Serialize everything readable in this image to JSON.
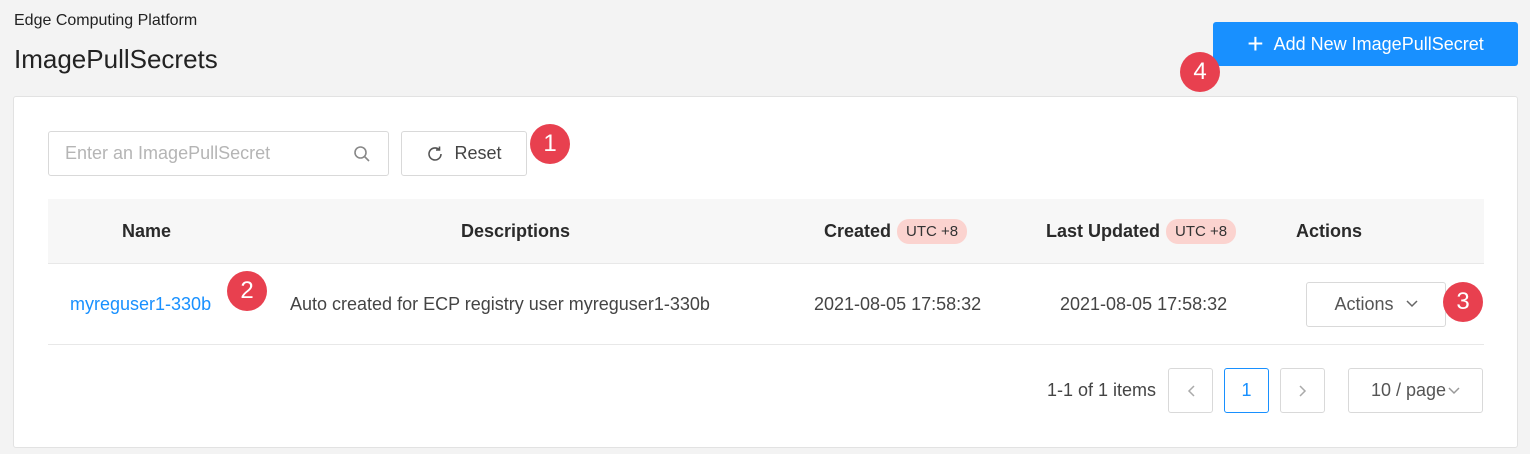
{
  "header": {
    "breadcrumb": "Edge Computing Platform",
    "title": "ImagePullSecrets",
    "add_button_label": "Add New ImagePullSecret"
  },
  "toolbar": {
    "search_placeholder": "Enter an ImagePullSecret",
    "search_value": "",
    "reset_label": "Reset"
  },
  "table": {
    "columns": {
      "name": "Name",
      "descriptions": "Descriptions",
      "created": "Created",
      "created_badge": "UTC +8",
      "updated": "Last Updated",
      "updated_badge": "UTC +8",
      "actions": "Actions"
    },
    "rows": [
      {
        "name": "myreguser1-330b",
        "description": "Auto created for ECP registry user myreguser1-330b",
        "created": "2021-08-05 17:58:32",
        "updated": "2021-08-05 17:58:32",
        "actions_label": "Actions"
      }
    ]
  },
  "pagination": {
    "total_text": "1-1 of 1 items",
    "current_page": "1",
    "page_size_label": "10 / page"
  },
  "markers": [
    "1",
    "2",
    "3",
    "4"
  ],
  "colors": {
    "primary": "#1890ff",
    "marker": "#e8404f",
    "badge_bg": "#fbd3cf"
  }
}
